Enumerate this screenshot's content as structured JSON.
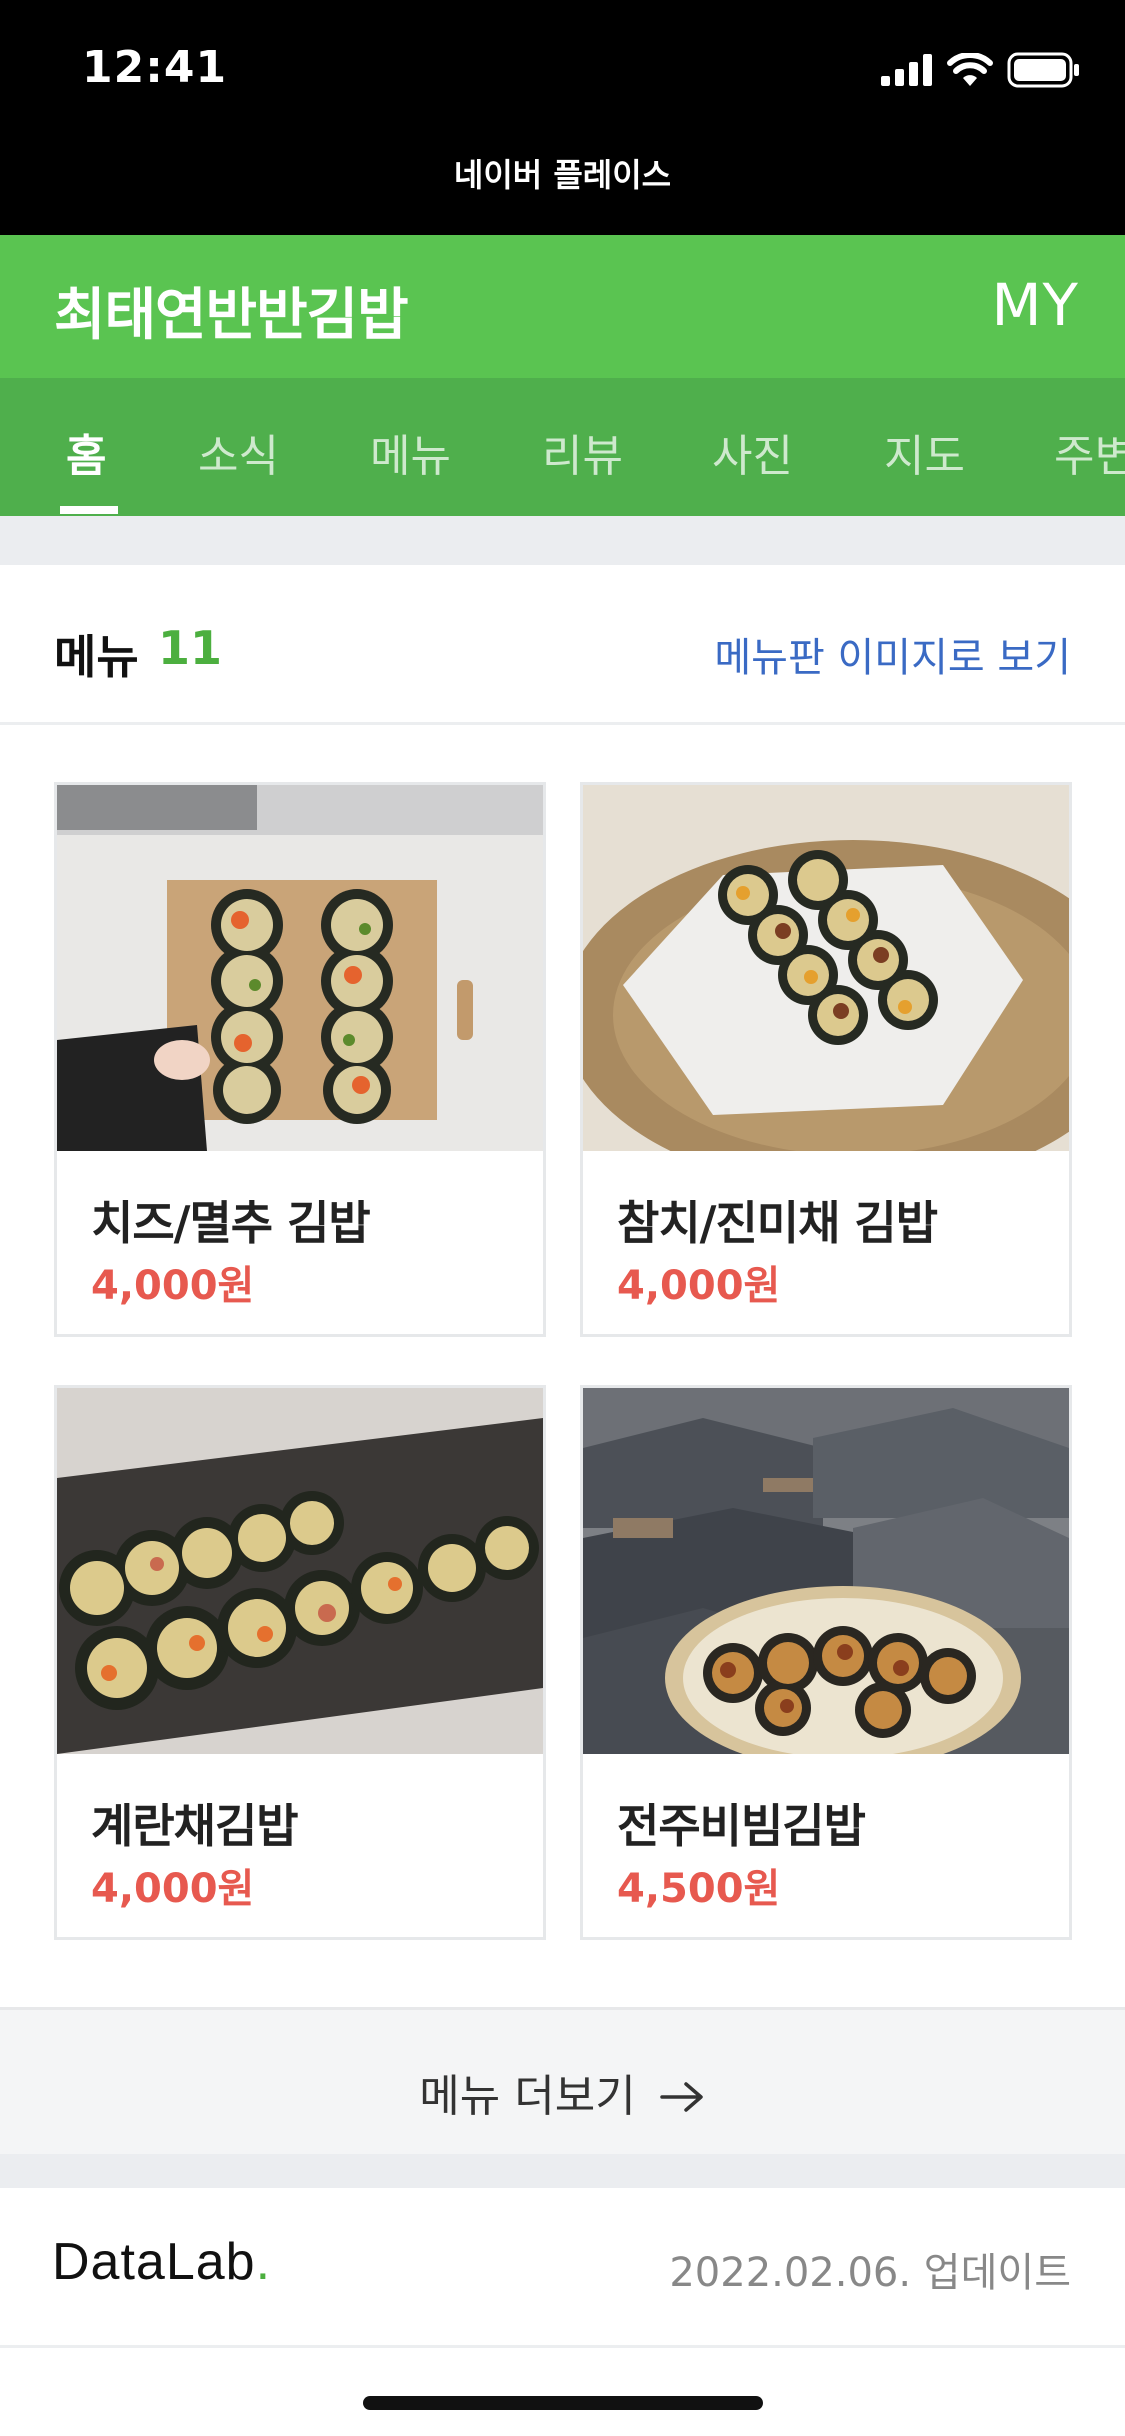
{
  "status_bar": {
    "time": "12:41"
  },
  "site_title": "네이버 플레이스",
  "header": {
    "store_name": "최태연반반김밥",
    "my_label": "MY"
  },
  "tabs": [
    {
      "label": "홈",
      "active": true
    },
    {
      "label": "소식",
      "active": false
    },
    {
      "label": "메뉴",
      "active": false
    },
    {
      "label": "리뷰",
      "active": false
    },
    {
      "label": "사진",
      "active": false
    },
    {
      "label": "지도",
      "active": false
    },
    {
      "label": "주변",
      "active": false
    }
  ],
  "menu_section": {
    "title": "메뉴",
    "count": "11",
    "image_link": "메뉴판 이미지로 보기",
    "items": [
      {
        "name": "치즈/멸추 김밥",
        "price": "4,000원"
      },
      {
        "name": "참치/진미채 김밥",
        "price": "4,000원"
      },
      {
        "name": "계란채김밥",
        "price": "4,000원"
      },
      {
        "name": "전주비빔김밥",
        "price": "4,500원"
      }
    ],
    "more_label": "메뉴 더보기"
  },
  "datalab": {
    "logo": "DataLab",
    "logo_dot": ".",
    "update_text": "2022.02.06. 업데이트"
  },
  "colors": {
    "brand_green": "#5ac451",
    "tab_green": "#4faf4c",
    "price_red": "#e7594f",
    "link_blue": "#3a6ac4"
  }
}
